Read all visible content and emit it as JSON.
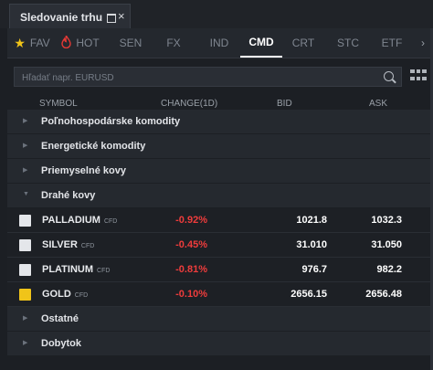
{
  "window": {
    "title": "Sledovanie trhu",
    "close": "×"
  },
  "tabs": [
    {
      "label": "FAV",
      "icon": "star-icon"
    },
    {
      "label": "HOT",
      "icon": "fire-icon"
    },
    {
      "label": "SEN"
    },
    {
      "label": "FX"
    },
    {
      "label": "IND"
    },
    {
      "label": "CMD",
      "active": true
    },
    {
      "label": "CRT"
    },
    {
      "label": "STC"
    },
    {
      "label": "ETF"
    }
  ],
  "tabs_more": "›",
  "search": {
    "placeholder": "Hľadať napr. EURUSD",
    "value": ""
  },
  "columns": {
    "symbol": "SYMBOL",
    "change": "CHANGE(1D)",
    "bid": "BID",
    "ask": "ASK"
  },
  "groups_top": [
    {
      "label": "Poľnohospodárske komodity"
    },
    {
      "label": "Energetické komodity"
    },
    {
      "label": "Priemyselné kovy"
    }
  ],
  "group_open": {
    "label": "Drahé kovy"
  },
  "instruments": [
    {
      "symbol": "PALLADIUM",
      "tag": "CFD",
      "change": "-0.92%",
      "bid": "1021.8",
      "ask": "1032.3"
    },
    {
      "symbol": "SILVER",
      "tag": "CFD",
      "change": "-0.45%",
      "bid": "31.010",
      "ask": "31.050"
    },
    {
      "symbol": "PLATINUM",
      "tag": "CFD",
      "change": "-0.81%",
      "bid": "976.7",
      "ask": "982.2"
    },
    {
      "symbol": "GOLD",
      "tag": "CFD",
      "change": "-0.10%",
      "bid": "2656.15",
      "ask": "2656.48"
    }
  ],
  "groups_bottom": [
    {
      "label": "Ostatné"
    },
    {
      "label": "Dobytok"
    }
  ],
  "colors": {
    "negative": "#ef3c3c",
    "active_tab": "#ffffff",
    "star": "#f0c419",
    "fire": "#e53935"
  }
}
